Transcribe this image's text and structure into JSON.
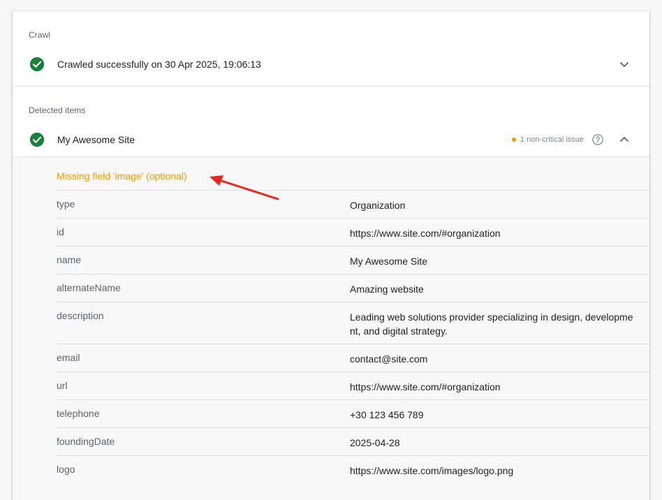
{
  "crawl": {
    "section_label": "Crawl",
    "status_text": "Crawled successfully on 30 Apr 2025, 19:06:13",
    "status_icon": "check-circle-icon",
    "expand_icon": "chevron-down-icon"
  },
  "detected": {
    "section_label": "Detected items",
    "item_title": "My Awesome Site",
    "item_icon": "check-circle-icon",
    "issue_text": "1 non-critical issue",
    "help_icon": "help-circle-icon",
    "collapse_icon": "chevron-up-icon"
  },
  "details": {
    "missing_field": "Missing field 'image' (optional)",
    "properties": [
      {
        "key": "type",
        "value": "Organization"
      },
      {
        "key": "id",
        "value": "https://www.site.com/#organization"
      },
      {
        "key": "name",
        "value": "My Awesome Site"
      },
      {
        "key": "alternateName",
        "value": "Amazing website"
      },
      {
        "key": "description",
        "value": "Leading web solutions provider specializing in design, development, and digital strategy."
      },
      {
        "key": "email",
        "value": "contact@site.com"
      },
      {
        "key": "url",
        "value": "https://www.site.com/#organization"
      },
      {
        "key": "telephone",
        "value": "+30 123 456 789"
      },
      {
        "key": "foundingDate",
        "value": "2025-04-28"
      },
      {
        "key": "logo",
        "value": "https://www.site.com/images/logo.png"
      }
    ]
  },
  "colors": {
    "success_green": "#188038",
    "warning_orange": "#f29900",
    "annotation_red": "#e8261c"
  }
}
